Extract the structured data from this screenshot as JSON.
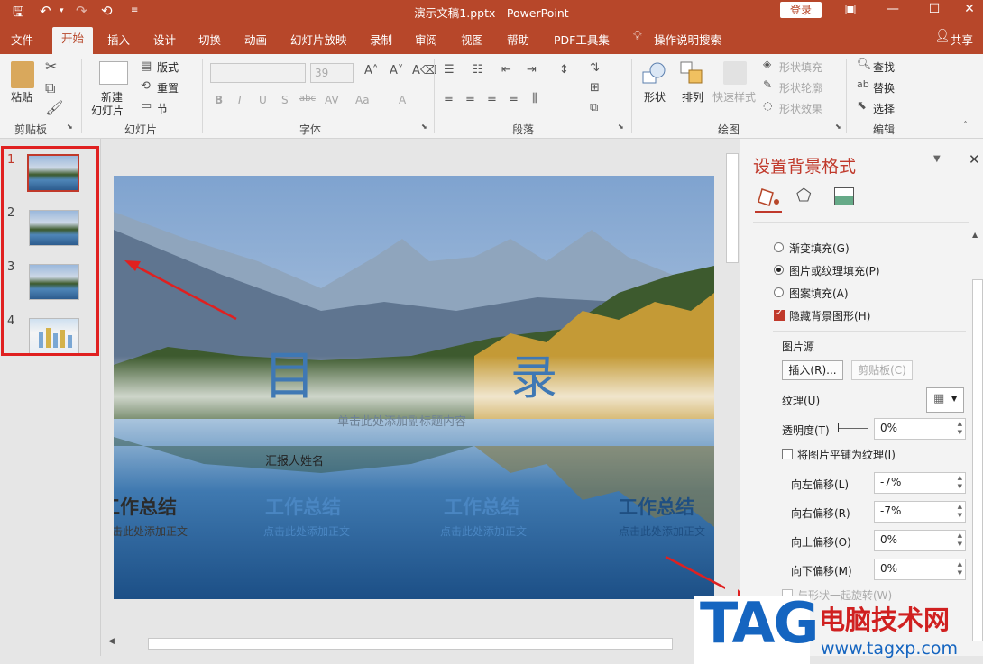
{
  "titlebar": {
    "title": "演示文稿1.pptx  -  PowerPoint",
    "login": "登录",
    "icons": [
      "save-icon",
      "undo-icon",
      "redo-icon",
      "presenter-icon",
      "customize-icon"
    ]
  },
  "tabs": [
    "文件",
    "开始",
    "插入",
    "设计",
    "切换",
    "动画",
    "幻灯片放映",
    "录制",
    "审阅",
    "视图",
    "帮助",
    "PDF工具集"
  ],
  "active_tab": "开始",
  "tell_me": "操作说明搜索",
  "share": "共享",
  "ribbon": {
    "clipboard": {
      "paste": "粘贴",
      "group": "剪贴板"
    },
    "slides": {
      "new_line1": "新建",
      "new_line2": "幻灯片",
      "layout": "版式",
      "reset": "重置",
      "section": "节",
      "group": "幻灯片"
    },
    "font": {
      "size": "39",
      "group": "字体",
      "buttons": [
        "B",
        "I",
        "U",
        "S",
        "abc",
        "AV",
        "Aa",
        "A"
      ]
    },
    "paragraph": {
      "group": "段落"
    },
    "drawing": {
      "shape": "形状",
      "arrange": "排列",
      "quick_styles": "快速样式",
      "fill": "形状填充",
      "outline": "形状轮廓",
      "effect": "形状效果",
      "group": "绘图"
    },
    "editing": {
      "find": "查找",
      "replace": "替换",
      "select": "选择",
      "group": "编辑"
    }
  },
  "thumbnails": [
    "1",
    "2",
    "3",
    "4"
  ],
  "slide": {
    "title_left": "目",
    "title_right": "录",
    "subtitle": "单击此处添加副标题内容",
    "reporter": "汇报人姓名",
    "items": [
      {
        "heading": "工作总结",
        "body": "点击此处添加正文"
      },
      {
        "heading": "工作总结",
        "body": "点击此处添加正文"
      },
      {
        "heading": "工作总结",
        "body": "点击此处添加正文"
      },
      {
        "heading": "工作总结",
        "body": "点击此处添加正文"
      }
    ]
  },
  "panel": {
    "title": "设置背景格式",
    "fill_options": [
      {
        "label": "渐变填充(G)",
        "checked": false
      },
      {
        "label": "图片或纹理填充(P)",
        "checked": true
      },
      {
        "label": "图案填充(A)",
        "checked": false
      }
    ],
    "hide_bg": "隐藏背景图形(H)",
    "picture_source": "图片源",
    "insert": "插入(R)...",
    "clipboard": "剪贴板(C)",
    "texture": "纹理(U)",
    "transparency_label": "透明度(T)",
    "transparency_value": "0%",
    "tile": "将图片平铺为纹理(I)",
    "offsets": [
      {
        "label": "向左偏移(L)",
        "value": "-7%"
      },
      {
        "label": "向右偏移(R)",
        "value": "-7%"
      },
      {
        "label": "向上偏移(O)",
        "value": "0%"
      },
      {
        "label": "向下偏移(M)",
        "value": "0%"
      }
    ],
    "rotate_with_shape": "与形状一起旋转(W)"
  },
  "watermark": {
    "logo": "TAG",
    "name": "电脑技术网",
    "url": "www.tagxp.com"
  },
  "colors": {
    "brand": "#b7472a",
    "highlight": "#e02020",
    "watermark_blue": "#1565c0"
  }
}
